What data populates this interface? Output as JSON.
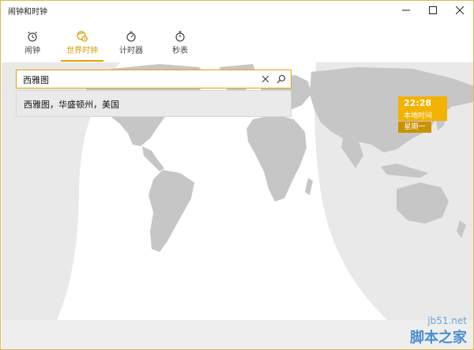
{
  "window": {
    "title": "闹钟和时钟"
  },
  "tabs": [
    {
      "label": "闹钟",
      "icon": "alarm-clock-icon",
      "active": false
    },
    {
      "label": "世界时钟",
      "icon": "world-clock-icon",
      "active": true
    },
    {
      "label": "计时器",
      "icon": "timer-icon",
      "active": false
    },
    {
      "label": "秒表",
      "icon": "stopwatch-icon",
      "active": false
    }
  ],
  "search": {
    "value": "西雅图"
  },
  "suggestions": [
    {
      "label": "西雅图，华盛顿州，美国"
    }
  ],
  "local_clock": {
    "time": "22:28",
    "label": "本地时间",
    "day": "星期一"
  },
  "watermark": {
    "site": "jb51.net",
    "title": "脚本之家"
  },
  "colors": {
    "accent": "#f3b200",
    "accent_dark": "#c79300",
    "land": "#c9c9c9",
    "night": "#e8e8e8"
  }
}
